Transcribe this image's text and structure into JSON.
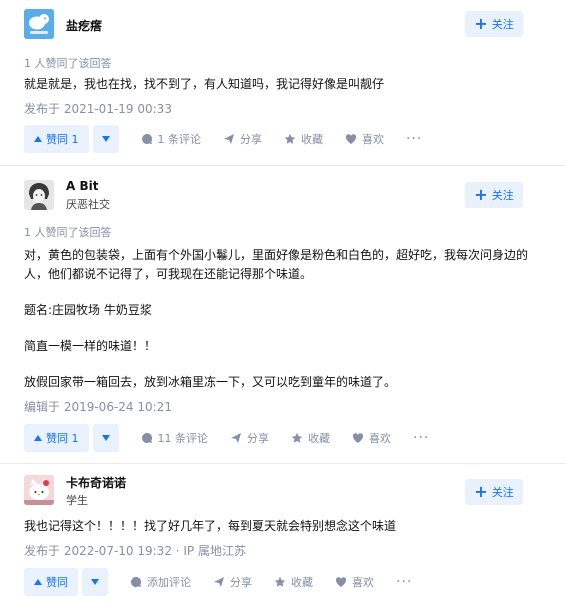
{
  "answers": [
    {
      "author": {
        "name": "盐疙瘩",
        "headline": ""
      },
      "follow_label": "关注",
      "vote_summary": "1 人赞同了该回答",
      "paragraphs": [
        "就是就是，我也在找，找不到了，有人知道吗，我记得好像是叫靓仔"
      ],
      "date": "发布于 2021-01-19 00:33",
      "vote_label": "赞同 1",
      "comments_label": "1 条评论",
      "share_label": "分享",
      "collect_label": "收藏",
      "like_label": "喜欢",
      "more_label": "···",
      "avatar_icon": "zhihu-default-avatar-icon"
    },
    {
      "author": {
        "name": "A Bit",
        "headline": "厌恶社交"
      },
      "follow_label": "关注",
      "vote_summary": "1 人赞同了该回答",
      "paragraphs": [
        "对，黄色的包装袋，上面有个外国小鬈儿，里面好像是粉色和白色的，超好吃，我每次问身边的人，他们都说不记得了，可我现在还能记得那个味道。",
        "题名:庄园牧场 牛奶豆浆",
        "简直一模一样的味道！！",
        "放假回家带一箱回去，放到冰箱里冻一下，又可以吃到童年的味道了。"
      ],
      "date": "编辑于 2019-06-24 10:21",
      "vote_label": "赞同 1",
      "comments_label": "11 条评论",
      "share_label": "分享",
      "collect_label": "收藏",
      "like_label": "喜欢",
      "more_label": "···",
      "avatar_icon": "sketch-portrait-avatar"
    },
    {
      "author": {
        "name": "卡布奇诺诺",
        "headline": "学生"
      },
      "follow_label": "关注",
      "vote_summary": "",
      "paragraphs": [
        "我也记得这个！！！！找了好几年了，每到夏天就会特别想念这个味道"
      ],
      "date": "发布于 2022-07-10 19:32 · IP 属地江苏",
      "vote_label": "赞同",
      "comments_label": "添加评论",
      "share_label": "分享",
      "collect_label": "收藏",
      "like_label": "喜欢",
      "more_label": "···",
      "avatar_icon": "hello-kitty-avatar"
    }
  ],
  "colors": {
    "accent": "#1772f6",
    "accent_bg": "#e8f1fc",
    "meta": "#8590a6",
    "text": "#121212"
  }
}
